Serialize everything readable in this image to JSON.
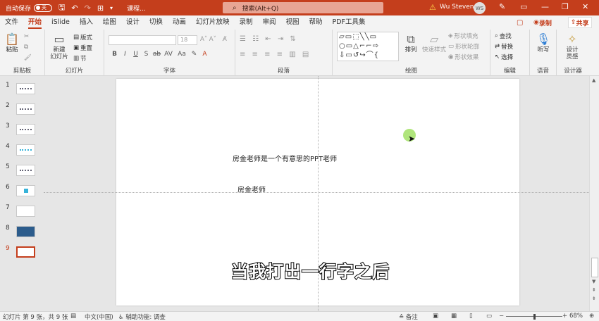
{
  "titlebar": {
    "autosave_label": "自动保存",
    "autosave_state": "关",
    "doc_title": "课程... ",
    "search_placeholder": "搜索(Alt+Q)",
    "username": "Wu Steven",
    "avatar_initials": "WS",
    "accent_color": "#c43e1c"
  },
  "tabs": [
    "文件",
    "开始",
    "iSlide",
    "插入",
    "绘图",
    "设计",
    "切换",
    "动画",
    "幻灯片放映",
    "录制",
    "审阅",
    "视图",
    "帮助",
    "PDF工具集"
  ],
  "active_tab": "开始",
  "tab_right": {
    "record": "录制",
    "share": "共享"
  },
  "ribbon": {
    "clipboard": {
      "paste": "粘贴",
      "label": "剪贴板"
    },
    "slides": {
      "new_slide_line1": "新建",
      "new_slide_line2": "幻灯片",
      "layout": "版式",
      "reset": "重置",
      "section": "节",
      "label": "幻灯片"
    },
    "font": {
      "size": "18",
      "label": "字体",
      "buttons": [
        "B",
        "I",
        "U",
        "S",
        "ab",
        "AV",
        "Aa"
      ]
    },
    "paragraph": {
      "label": "段落"
    },
    "drawing": {
      "arrange": "排列",
      "quick_styles": "快速样式",
      "shape_fill": "形状填充",
      "shape_outline": "形状轮廓",
      "shape_effects": "形状效果",
      "label": "绘图"
    },
    "editing": {
      "find": "查找",
      "replace": "替换",
      "select": "选择",
      "label": "编辑"
    },
    "voice": {
      "dictate": "听写",
      "label": "语音"
    },
    "designer": {
      "design_line1": "设计",
      "design_line2": "灵感",
      "label": "设计器"
    }
  },
  "slides": [
    {
      "num": "1",
      "style": "lines"
    },
    {
      "num": "2",
      "style": "lines"
    },
    {
      "num": "3",
      "style": "lines"
    },
    {
      "num": "4",
      "style": "lines"
    },
    {
      "num": "5",
      "style": "lines"
    },
    {
      "num": "6",
      "style": "cyan"
    },
    {
      "num": "7",
      "style": "blank"
    },
    {
      "num": "8",
      "style": "dark"
    },
    {
      "num": "9",
      "style": "blank"
    }
  ],
  "selected_slide": "9",
  "slide_content": {
    "line1": "房金老师是一个有意思的PPT老师",
    "line2": "房金老师",
    "subtitle": "当我打出一行字之后"
  },
  "status": {
    "slide_info": "幻灯片 第 9 张，共 9 张",
    "language": "中文(中国)",
    "accessibility": "辅助功能: 调查",
    "notes": "备注",
    "zoom": "68%"
  }
}
